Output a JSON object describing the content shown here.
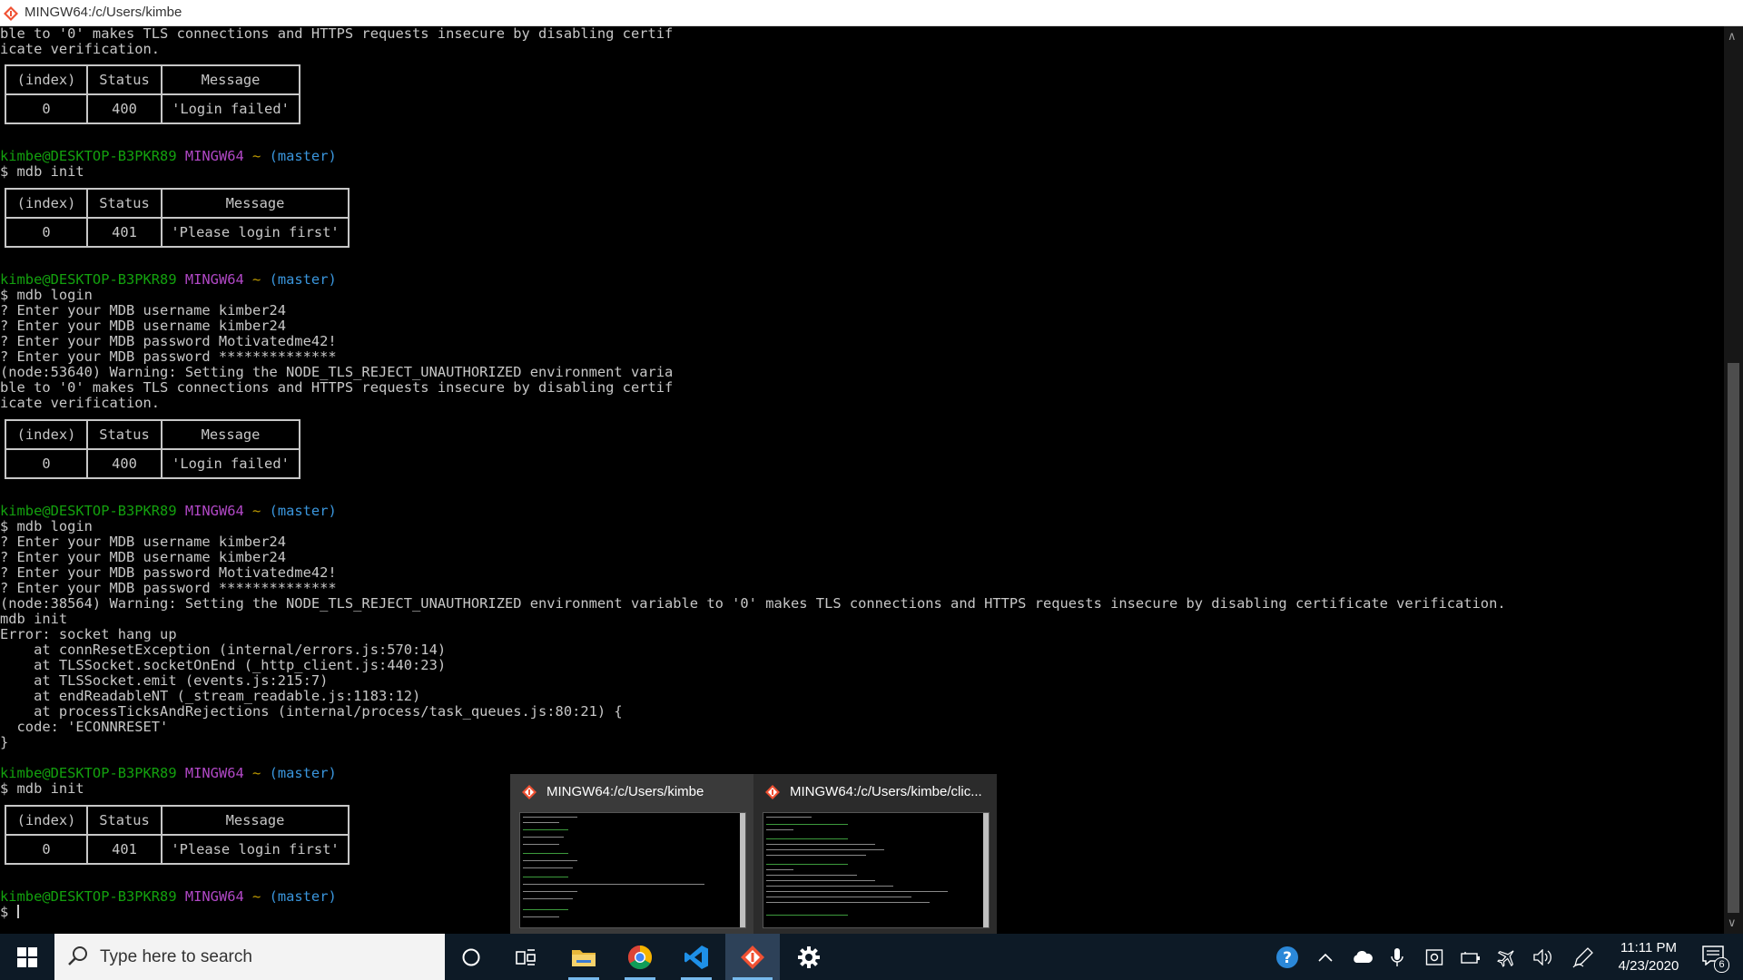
{
  "window": {
    "title": "MINGW64:/c/Users/kimbe"
  },
  "colors": {
    "prompt_user": "#13a10e",
    "prompt_env": "#b148c6",
    "prompt_dir": "#c19c00",
    "prompt_branch": "#3a96dd",
    "text": "#c7c7c7"
  },
  "prompt": {
    "user": "kimbe@DESKTOP-B3PKR89",
    "env": "MINGW64",
    "dir": "~",
    "branch": "(master)"
  },
  "terminal": {
    "l1": "ble to '0' makes TLS connections and HTTPS requests insecure by disabling certif",
    "l2": "icate verification.",
    "cmd1": "$ mdb init",
    "cmd2": "$ mdb login",
    "login_a": [
      "? Enter your MDB username kimber24",
      "? Enter your MDB username kimber24",
      "? Enter your MDB password Motivatedme42!",
      "? Enter your MDB password **************",
      "(node:53640) Warning: Setting the NODE_TLS_REJECT_UNAUTHORIZED environment varia",
      "ble to '0' makes TLS connections and HTTPS requests insecure by disabling certif",
      "icate verification."
    ],
    "cmd3": "$ mdb login",
    "login_b": [
      "? Enter your MDB username kimber24",
      "? Enter your MDB username kimber24",
      "? Enter your MDB password Motivatedme42!",
      "? Enter your MDB password **************",
      "(node:38564) Warning: Setting the NODE_TLS_REJECT_UNAUTHORIZED environment variable to '0' makes TLS connections and HTTPS requests insecure by disabling certificate verification.",
      "mdb init",
      "Error: socket hang up",
      "    at connResetException (internal/errors.js:570:14)",
      "    at TLSSocket.socketOnEnd (_http_client.js:440:23)",
      "    at TLSSocket.emit (events.js:215:7)",
      "    at endReadableNT (_stream_readable.js:1183:12)",
      "    at processTicksAndRejections (internal/process/task_queues.js:80:21) {",
      "  code: 'ECONNRESET'",
      "}"
    ],
    "cmd4": "$ mdb init",
    "final_prompt": "$ "
  },
  "table_headers": [
    "(index)",
    "Status",
    "Message"
  ],
  "tables": {
    "t1": {
      "index": "0",
      "status": "400",
      "message": "'Login failed'"
    },
    "t2": {
      "index": "0",
      "status": "401",
      "message": "'Please login first'"
    },
    "t3": {
      "index": "0",
      "status": "400",
      "message": "'Login failed'"
    },
    "t4": {
      "index": "0",
      "status": "401",
      "message": "'Please login first'"
    }
  },
  "previews": [
    {
      "title": "MINGW64:/c/Users/kimbe"
    },
    {
      "title": "MINGW64:/c/Users/kimbe/clic..."
    }
  ],
  "taskbar": {
    "search_placeholder": "Type here to search",
    "time": "11:11 PM",
    "date": "4/23/2020",
    "notification_count": "6"
  }
}
